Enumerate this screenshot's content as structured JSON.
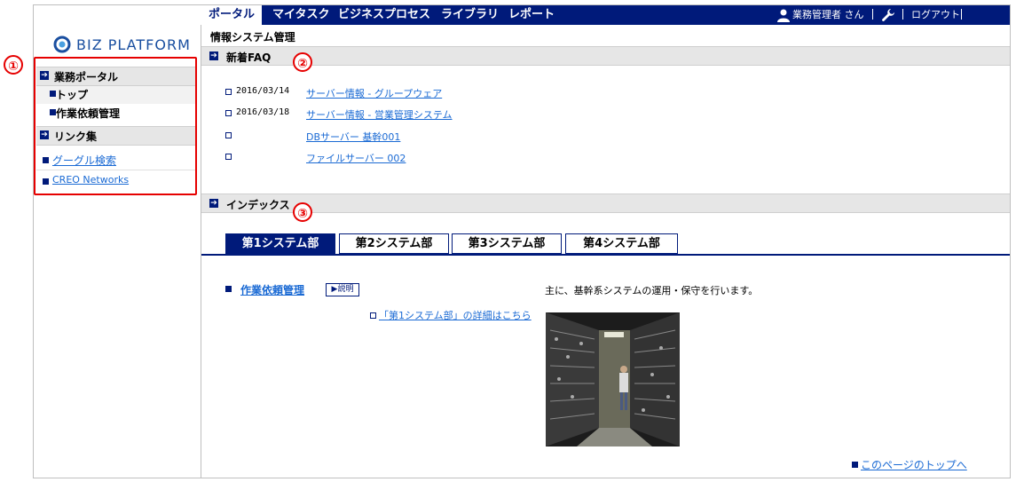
{
  "nav": {
    "tabs": [
      "ポータル",
      "マイタスク",
      "ビジネスプロセス",
      "ライブラリ",
      "レポート"
    ],
    "active": 0,
    "user": "業務管理者 さん",
    "logout": "ログアウト"
  },
  "logo": {
    "text": "BIZ PLATFORM"
  },
  "sidebar": {
    "portal_header": "業務ポータル",
    "portal_items": [
      "トップ",
      "作業依頼管理"
    ],
    "links_header": "リンク集",
    "links": [
      "グーグル検索",
      "CREO Networks"
    ]
  },
  "annotations": [
    "①",
    "②",
    "③"
  ],
  "page": {
    "title": "情報システム管理",
    "faq_header": "新着FAQ",
    "faq": [
      {
        "date": "2016/03/14",
        "title": "サーバー情報 - グループウェア"
      },
      {
        "date": "2016/03/18",
        "title": "サーバー情報 - 営業管理システム"
      },
      {
        "date": "",
        "title": "DBサーバー 基幹001"
      },
      {
        "date": "",
        "title": "ファイルサーバー 002"
      }
    ],
    "index_header": "インデックス",
    "tabs": [
      "第1システム部",
      "第2システム部",
      "第3システム部",
      "第4システム部"
    ],
    "active_tab": 0,
    "task_link": "作業依頼管理",
    "explain_button": "▶説明",
    "detail_link": "「第1システム部」の詳細はこちら",
    "description": "主に、基幹系システムの運用・保守を行います。",
    "back_to_top": "このページのトップへ"
  },
  "colors": {
    "nav": "#001a7a",
    "link": "#1a6ad4",
    "annotation": "#e60000"
  }
}
